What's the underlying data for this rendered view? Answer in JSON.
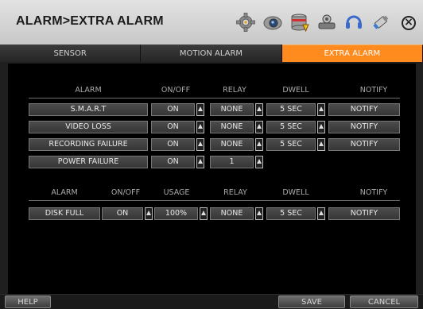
{
  "title": "ALARM>EXTRA ALARM",
  "toolbar_icons": [
    "gear-icon",
    "camera-icon",
    "database-icon",
    "network-icon",
    "headset-icon",
    "usb-icon"
  ],
  "tabs": [
    {
      "label": "SENSOR",
      "active": false
    },
    {
      "label": "MOTION ALARM",
      "active": false
    },
    {
      "label": "EXTRA ALARM",
      "active": true
    }
  ],
  "table1": {
    "headers": {
      "alarm": "ALARM",
      "onoff": "ON/OFF",
      "relay": "RELAY",
      "dwell": "DWELL",
      "notify": "NOTIFY"
    },
    "rows": [
      {
        "name": "S.M.A.R.T",
        "onoff": "ON",
        "relay": "NONE",
        "dwell": "5 SEC",
        "notify": "NOTIFY"
      },
      {
        "name": "VIDEO LOSS",
        "onoff": "ON",
        "relay": "NONE",
        "dwell": "5 SEC",
        "notify": "NOTIFY"
      },
      {
        "name": "RECORDING FAILURE",
        "onoff": "ON",
        "relay": "NONE",
        "dwell": "5 SEC",
        "notify": "NOTIFY"
      },
      {
        "name": "POWER FAILURE",
        "onoff": "ON",
        "relay": "1"
      }
    ]
  },
  "table2": {
    "headers": {
      "alarm": "ALARM",
      "onoff": "ON/OFF",
      "usage": "USAGE",
      "relay": "RELAY",
      "dwell": "DWELL",
      "notify": "NOTIFY"
    },
    "row": {
      "name": "DISK FULL",
      "onoff": "ON",
      "usage": "100%",
      "relay": "NONE",
      "dwell": "5 SEC",
      "notify": "NOTIFY"
    }
  },
  "buttons": {
    "help": "HELP",
    "save": "SAVE",
    "cancel": "CANCEL"
  },
  "colors": {
    "active_tab": "#ff8a1e",
    "background": "#000000",
    "titlebar": "#d6d6d6"
  }
}
